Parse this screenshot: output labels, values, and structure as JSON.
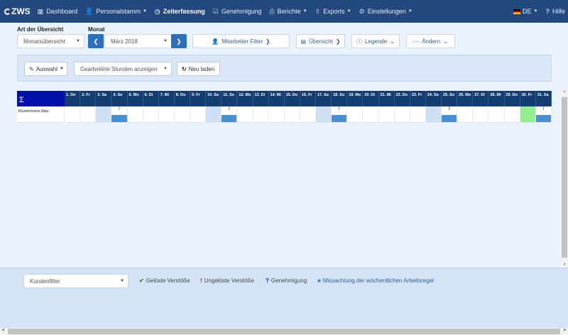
{
  "nav": {
    "brand": "ZWS",
    "items": [
      {
        "label": "Dashboard",
        "icon": "dashboard-icon",
        "glyph": "▦",
        "caret": false,
        "active": false
      },
      {
        "label": "Personalstamm",
        "icon": "person-icon",
        "glyph": "👤",
        "caret": true,
        "active": false
      },
      {
        "label": "Zeiterfassung",
        "icon": "clock-icon",
        "glyph": "◷",
        "caret": false,
        "active": true
      },
      {
        "label": "Genehmigung",
        "icon": "check-square-icon",
        "glyph": "☑",
        "caret": false,
        "active": false
      },
      {
        "label": "Berichte",
        "icon": "print-icon",
        "glyph": "⎙",
        "caret": true,
        "active": false
      },
      {
        "label": "Exports",
        "icon": "export-icon",
        "glyph": "⇪",
        "caret": true,
        "active": false
      },
      {
        "label": "Einstellungen",
        "icon": "gear-icon",
        "glyph": "⚙",
        "caret": true,
        "active": false
      }
    ],
    "lang": "DE",
    "help": "Hilfe"
  },
  "controls": {
    "type_label": "Art der Übersicht",
    "type_value": "Monatsübersicht",
    "month_label": "Monat",
    "month_value": "März 2018",
    "prev": "❮",
    "next": "❯",
    "employee_filter": "Mitarbeiter Filter",
    "overview": "Übersicht",
    "legend": "Legende",
    "change": "Ändern"
  },
  "toolbar": {
    "selection": "Auswahl",
    "hours_mode": "Gearbeitete Stunden anzeigen",
    "reload": "Neu laden"
  },
  "grid": {
    "sigma": "Σ",
    "days": [
      "1. Do",
      "2. Fr",
      "3. Sa",
      "4. So",
      "5. Mo",
      "6. Di",
      "7. Mi",
      "8. Do",
      "9. Fr",
      "10. Sa",
      "11. So",
      "12. Mo",
      "13. Di",
      "14. Mi",
      "15. Do",
      "16. Fr",
      "17. Sa",
      "18. So",
      "19. Mo",
      "20. Di",
      "21. Mi",
      "22. Do",
      "23. Fr",
      "24. Sa",
      "25. So",
      "26. Mo",
      "27. Di",
      "28. Mi",
      "29. Do",
      "30. Fr",
      "31. Sa"
    ],
    "rows": [
      {
        "name": "Mustermann Max",
        "cells": [
          "",
          "",
          "we",
          "we-v",
          "",
          "",
          "",
          "",
          "",
          "we",
          "we-v",
          "",
          "",
          "",
          "",
          "",
          "we",
          "we-v",
          "",
          "",
          "",
          "",
          "",
          "we",
          "we-v",
          "",
          "",
          "",
          "",
          "green",
          "we-v"
        ]
      }
    ]
  },
  "bottom": {
    "customer_filter": "Kundenfilter",
    "legend": [
      {
        "symbol": "✔",
        "label": "Gelöste Verstöße",
        "color": "#2a8a2a",
        "icon": "check-icon"
      },
      {
        "symbol": "!",
        "label": "Ungelöste Verstöße",
        "color": "#d11111",
        "icon": "exclamation-icon"
      },
      {
        "symbol": "?",
        "label": "Genehmigung",
        "color": "#1a1aa8",
        "icon": "question-icon"
      },
      {
        "symbol": "■",
        "label": "Missachtung der wöchentlichen Arbeitsregel",
        "color": "#4a8ed4",
        "icon": "blue-square-icon"
      }
    ]
  }
}
